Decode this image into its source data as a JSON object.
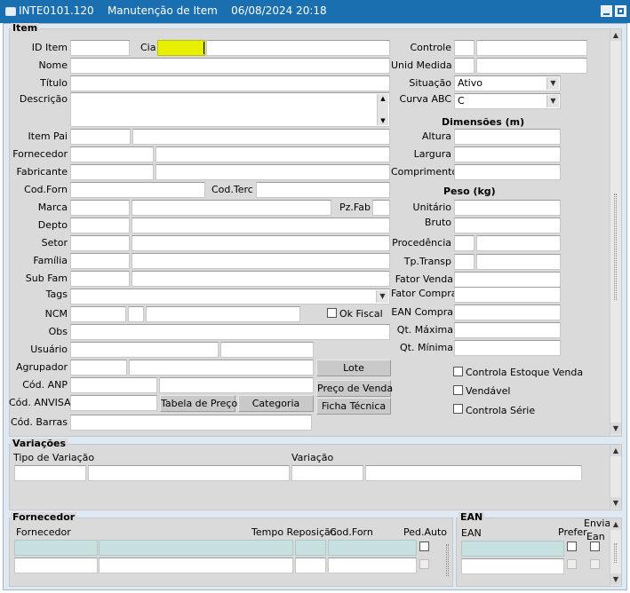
{
  "window": {
    "app_code": "INTE0101.120",
    "title": "Manutenção de Item",
    "datetime": "06/08/2024 20:18"
  },
  "item_section": {
    "title": "Item",
    "labels": {
      "id_item": "ID Item",
      "cia": "Cia",
      "nome": "Nome",
      "titulo": "Título",
      "descricao": "Descrição",
      "item_pai": "Item Pai",
      "fornecedor": "Fornecedor",
      "fabricante": "Fabricante",
      "cod_forn": "Cod.Forn",
      "cod_terc": "Cod.Terc",
      "marca": "Marca",
      "pz_fab": "Pz.Fab",
      "depto": "Depto",
      "setor": "Setor",
      "familia": "Família",
      "sub_fam": "Sub Fam",
      "tags": "Tags",
      "ncm": "NCM",
      "ok_fiscal": "Ok Fiscal",
      "obs": "Obs",
      "usuario": "Usuário",
      "agrupador": "Agrupador",
      "cod_anp": "Cód. ANP",
      "cod_anvisa": "Cód. ANVISA",
      "cod_barras": "Cód. Barras",
      "controle": "Controle",
      "unid_medida": "Unid Medida",
      "situacao": "Situação",
      "curva_abc": "Curva ABC",
      "altura": "Altura",
      "largura": "Largura",
      "comprimento": "Comprimento",
      "unitario": "Unitário",
      "bruto": "Bruto",
      "procedencia": "Procedência",
      "tp_transp": "Tp.Transp",
      "fator_venda": "Fator Venda",
      "fator_compra": "Fator Compra",
      "ean_compra": "EAN Compra",
      "qt_maxima": "Qt. Máxima",
      "qt_minima": "Qt. Mínima"
    },
    "headings": {
      "dimensoes": "Dimensões (m)",
      "peso": "Peso (kg)"
    },
    "values": {
      "situacao": "Ativo",
      "curva_abc": "C"
    },
    "buttons": {
      "lote": "Lote",
      "preco_venda": "Preço de Venda",
      "ficha_tecnica": "Ficha Técnica",
      "tabela_preco": "Tabela de Preço",
      "categoria": "Categoria"
    },
    "checkboxes": {
      "controla_estoque_venda": "Controla Estoque Venda",
      "vendavel": "Vendável",
      "controla_serie": "Controla Série"
    }
  },
  "variacoes": {
    "title": "Variações",
    "col_tipo": "Tipo de Variação",
    "col_variacao": "Variação"
  },
  "fornecedor_section": {
    "title": "Fornecedor",
    "columns": {
      "fornecedor": "Fornecedor",
      "tempo_reposicao": "Tempo Reposição",
      "cod_forn": "Cod.Forn",
      "ped_auto": "Ped.Auto"
    }
  },
  "ean_section": {
    "title": "EAN",
    "columns": {
      "ean": "EAN",
      "prefer": "Prefer",
      "envia": "Envia",
      "ean2": "Ean"
    }
  },
  "colors": {
    "titlebar": "#1a6fb0",
    "frame": "#dee9f3",
    "panel": "#dadada",
    "highlight": "#e8f000",
    "row_teal": "#c7e0e0"
  }
}
